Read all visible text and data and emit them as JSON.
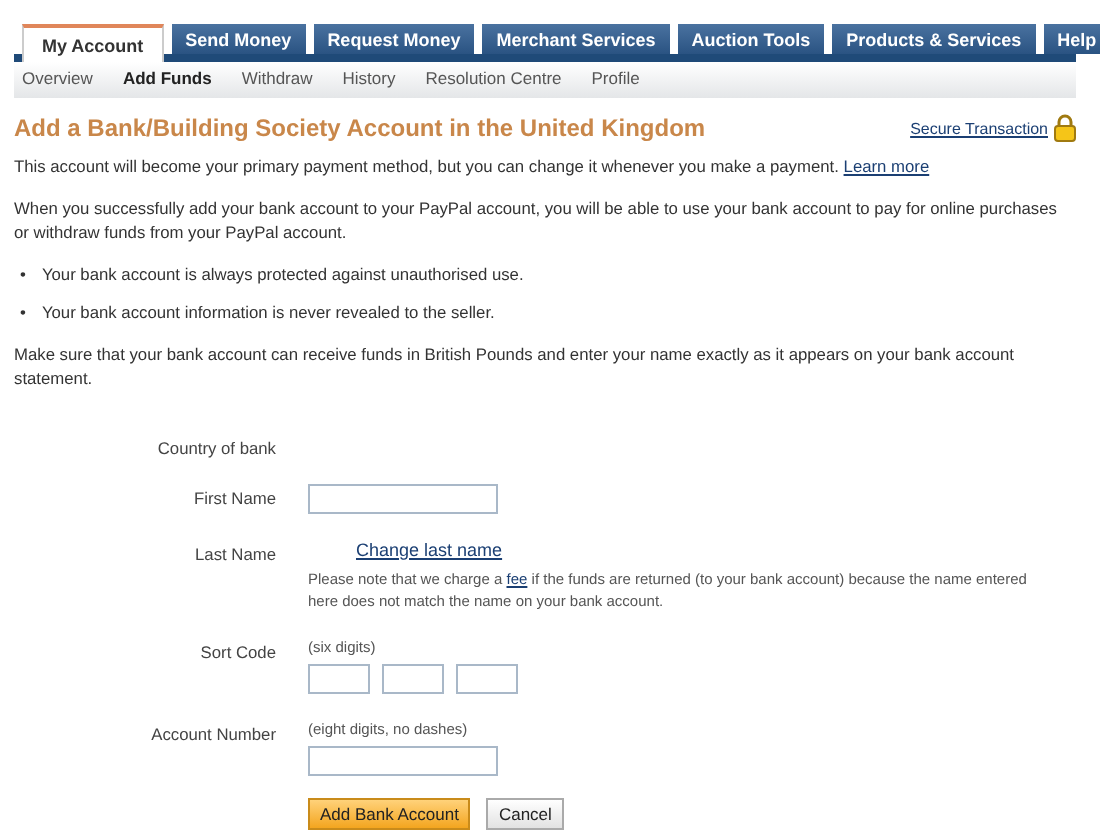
{
  "tabs": [
    {
      "label": "My Account",
      "selected": true
    },
    {
      "label": "Send Money",
      "selected": false
    },
    {
      "label": "Request Money",
      "selected": false
    },
    {
      "label": "Merchant Services",
      "selected": false
    },
    {
      "label": "Auction Tools",
      "selected": false
    },
    {
      "label": "Products & Services",
      "selected": false
    },
    {
      "label": "Help",
      "selected": false
    }
  ],
  "subnav": [
    {
      "label": "Overview",
      "selected": false
    },
    {
      "label": "Add Funds",
      "selected": true
    },
    {
      "label": "Withdraw",
      "selected": false
    },
    {
      "label": "History",
      "selected": false
    },
    {
      "label": "Resolution Centre",
      "selected": false
    },
    {
      "label": "Profile",
      "selected": false
    }
  ],
  "heading": "Add a Bank/Building Society Account in the United Kingdom",
  "secure_link": "Secure Transaction",
  "intro": {
    "text": "This account will become your primary payment method, but you can change it whenever you make a payment.",
    "link": "Learn more"
  },
  "paragraph": "When you successfully add your bank account to your PayPal account, you will be able to use your bank account to pay for online purchases or withdraw funds from your PayPal account.",
  "bullets": [
    {
      "marker": "•",
      "text": "Your bank account is always protected against unauthorised use."
    },
    {
      "marker": "•",
      "text": "Your bank account information is never revealed to the seller."
    }
  ],
  "instruction": "Make sure that your bank account can receive funds in British Pounds and enter your name exactly as it appears on your bank account statement.",
  "form": [
    {
      "kind": "static",
      "label": "Country of bank"
    },
    {
      "kind": "input",
      "label": "First Name"
    },
    {
      "kind": "link",
      "label": "Last Name",
      "link": "Change last name",
      "note_before": "Please note that we charge a",
      "note_link": "fee",
      "note_after": "if the funds are returned (to your bank account) because the name entered here does not match the name on your bank account."
    },
    {
      "kind": "split",
      "label": "Sort Code",
      "hint": "(six digits)"
    },
    {
      "kind": "input",
      "label": "Account Number",
      "hint": "(eight digits, no dashes)"
    }
  ],
  "buttons": [
    {
      "label": "Add Bank Account",
      "kind": "primary"
    },
    {
      "label": "Cancel",
      "kind": "secondary"
    }
  ]
}
